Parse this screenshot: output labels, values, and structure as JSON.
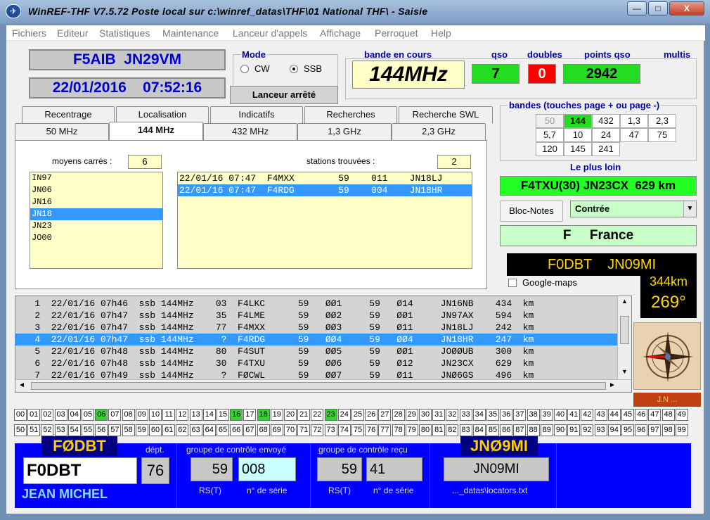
{
  "window": {
    "title": "WinREF-THF V7.5.72 Poste local sur c:\\winref_datas\\THF\\01 National THF\\ -   Saisie",
    "min_label": "—",
    "max_label": "□",
    "close_label": "X"
  },
  "menu": [
    "Fichiers",
    "Editeur",
    "Statistiques",
    "Maintenance",
    "Lanceur d'appels",
    "Affichage",
    "Perroquet",
    "Help"
  ],
  "station": {
    "call_loc": "F5AIB  JN29VM",
    "datetime": "22/01/2016    07:52:16"
  },
  "mode": {
    "title": "Mode",
    "options": [
      "CW",
      "SSB"
    ],
    "selected": "SSB"
  },
  "launcher_button": "Lanceur arrêté",
  "header_labels": {
    "band": "bande en cours",
    "qso": "qso",
    "doubles": "doubles",
    "points": "points qso",
    "multis": "multis"
  },
  "header_values": {
    "band": "144MHz",
    "qso": "7",
    "doubles": "0",
    "points": "2942",
    "colors": {
      "qso": "#22dd22",
      "doubles": "#ff0000",
      "points": "#22dd22",
      "band": "#ffffc8"
    }
  },
  "tabs_row1": [
    "Recentrage",
    "Localisation",
    "Indicatifs",
    "Recherches",
    "Recherche SWL"
  ],
  "tabs_row2": [
    "50 MHz",
    "144 MHz",
    "432 MHz",
    "1,3 GHz",
    "2,3 GHz"
  ],
  "active_tab": "144 MHz",
  "squares": {
    "label": "moyens carrés :",
    "count": "6",
    "items": [
      "IN97",
      "JN06",
      "JN16",
      "JN18",
      "JN23",
      "JO00"
    ],
    "selected": "JN18"
  },
  "stations": {
    "label": "stations trouvées :",
    "count": "2",
    "rows": [
      "22/01/16 07:47  F4MXX        59    011    JN18LJ",
      "22/01/16 07:47  F4RDG        59    004    JN18HR"
    ],
    "selected_index": 1
  },
  "bands": {
    "title": "bandes (touches page + ou page -)",
    "grid": [
      [
        "50",
        "144",
        "432",
        "1,3",
        "2,3"
      ],
      [
        "5,7",
        "10",
        "24",
        "47",
        "75"
      ],
      [
        "120",
        "145",
        "241"
      ]
    ],
    "active": "144",
    "inactive": "50"
  },
  "farthest": {
    "label": "Le plus loin",
    "value": "F4TXU(30) JN23CX  629 km"
  },
  "notepad_button": "Bloc-Notes",
  "country_select": {
    "value": "Contrée"
  },
  "country": "F     France",
  "target": {
    "call_loc": "F0DBT    JN09MI",
    "distance": "344km",
    "azimuth": "269°",
    "compass_caption": "J.N ..."
  },
  "google_maps": "Google-maps",
  "log_rows": [
    "   1  22/01/16 07h46  ssb 144MHz    03  F4LKC      59   ØØ1     59   Ø14     JN16NB    434  km",
    "   2  22/01/16 07h47  ssb 144MHz    35  F4LME      59   ØØ2     59   ØØ1     JN97AX    594  km",
    "   3  22/01/16 07h47  ssb 144MHz    77  F4MXX      59   ØØ3     59   Ø11     JN18LJ    242  km",
    "   4  22/01/16 07h47  ssb 144MHz     ?  F4RDG      59   ØØ4     59   ØØ4     JN18HR    247  km",
    "   5  22/01/16 07h48  ssb 144MHz    80  F4SUT      59   ØØ5     59   ØØ1     JOØØUB    300  km",
    "   6  22/01/16 07h48  ssb 144MHz    30  F4TXU      59   ØØ6     59   Ø12     JN23CX    629  km",
    "   7  22/01/16 07h49  ssb 144MHz     ?  FØCWL      59   ØØ7     59   Ø11     JNØ6GS    496  km"
  ],
  "log_selected": 3,
  "dept_numbers_row1": [
    "00",
    "01",
    "02",
    "03",
    "04",
    "05",
    "06",
    "07",
    "08",
    "09",
    "10",
    "11",
    "12",
    "13",
    "14",
    "15",
    "16",
    "17",
    "18",
    "19",
    "20",
    "21",
    "22",
    "23",
    "24",
    "25",
    "26",
    "27",
    "28",
    "29",
    "30",
    "31",
    "32",
    "33",
    "34",
    "35",
    "36",
    "37",
    "38",
    "39",
    "40",
    "41",
    "42",
    "43",
    "44",
    "45",
    "46",
    "47",
    "48",
    "49"
  ],
  "dept_numbers_row2": [
    "50",
    "51",
    "52",
    "53",
    "54",
    "55",
    "56",
    "57",
    "58",
    "59",
    "60",
    "61",
    "62",
    "63",
    "64",
    "65",
    "66",
    "67",
    "68",
    "69",
    "70",
    "71",
    "72",
    "73",
    "74",
    "75",
    "76",
    "77",
    "78",
    "79",
    "80",
    "81",
    "82",
    "83",
    "84",
    "85",
    "86",
    "87",
    "88",
    "89",
    "90",
    "91",
    "92",
    "93",
    "94",
    "95",
    "96",
    "97",
    "98",
    "99"
  ],
  "dept_highlighted": [
    "06",
    "16",
    "18",
    "23"
  ],
  "entry": {
    "call_tag": "FØDBT",
    "dept_label": "dépt.",
    "call_input": "F0DBT",
    "dept_value": "76",
    "name": "JEAN MICHEL",
    "sent_title": "groupe de contrôle envoyé",
    "sent_rst": "59",
    "sent_serial": "008",
    "rst_label": "RS(T)",
    "serial_label": "n° de série",
    "recv_title": "groupe de contrôle reçu",
    "recv_rst": "59",
    "recv_serial": "41",
    "loc_tag": "JNØ9MI",
    "loc_value": "JN09MI",
    "loc_file": "..._datas\\locators.txt"
  }
}
